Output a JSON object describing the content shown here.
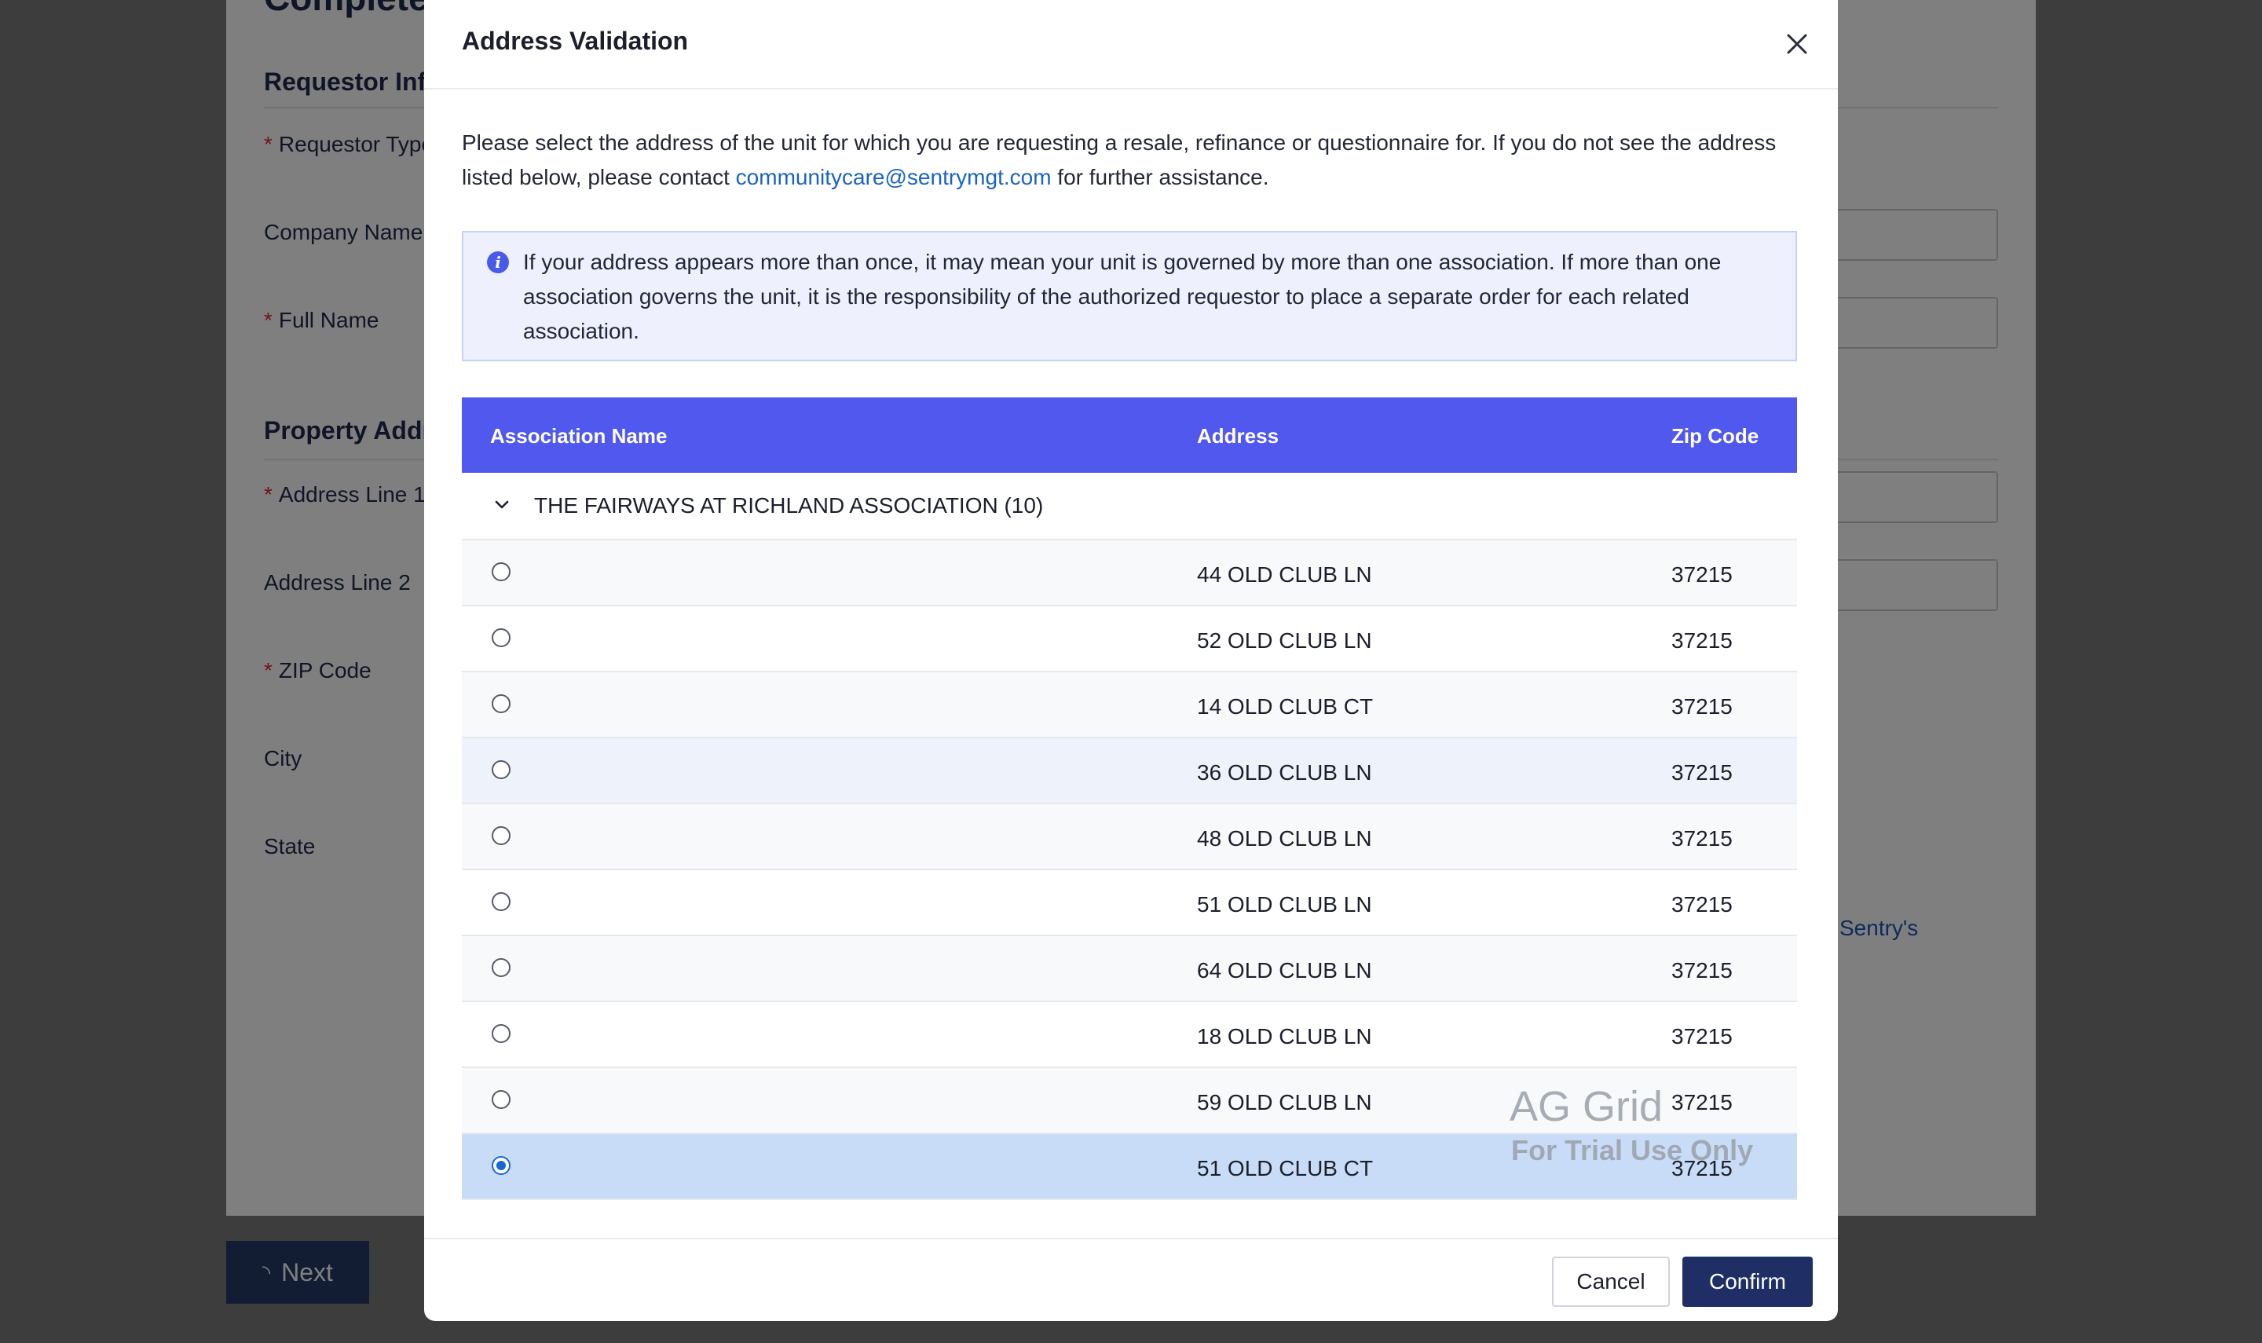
{
  "background": {
    "page_title": "Complete",
    "requestor_section": "Requestor Info",
    "requestor_type_label": "Requestor Type",
    "company_name_label": "Company Name",
    "full_name_label": "Full Name",
    "property_section": "Property Address",
    "address_line1_label": "Address Line 1",
    "address_line2_label": "Address Line 2",
    "zip_label": "ZIP Code",
    "city_label": "City",
    "state_label": "State",
    "partial_link": "Sentry's",
    "required_marker": "*",
    "next_label": "Next"
  },
  "modal": {
    "title": "Address Validation",
    "intro_before": "Please select the address of the unit for which you are requesting a resale, refinance or questionnaire for. If you do not see the address listed below, please contact ",
    "intro_email": "communitycare@sentrymgt.com",
    "intro_after": " for further assistance.",
    "info_icon": "info-icon",
    "info_text": "If your address appears more than once, it may mean your unit is governed by more than one association. If more than one association governs the unit, it is the responsibility of the authorized requestor to place a separate order for each related association.",
    "grid": {
      "columns": [
        "Association Name",
        "Address",
        "Zip Code"
      ],
      "group_label": "THE FAIRWAYS AT RICHLAND ASSOCIATION (10)",
      "rows": [
        {
          "address": "44 OLD CLUB LN",
          "zip": "37215",
          "selected": false
        },
        {
          "address": "52 OLD CLUB LN",
          "zip": "37215",
          "selected": false
        },
        {
          "address": "14 OLD CLUB CT",
          "zip": "37215",
          "selected": false
        },
        {
          "address": "36 OLD CLUB LN",
          "zip": "37215",
          "selected": false
        },
        {
          "address": "48 OLD CLUB LN",
          "zip": "37215",
          "selected": false
        },
        {
          "address": "51 OLD CLUB LN",
          "zip": "37215",
          "selected": false
        },
        {
          "address": "64 OLD CLUB LN",
          "zip": "37215",
          "selected": false
        },
        {
          "address": "18 OLD CLUB LN",
          "zip": "37215",
          "selected": false
        },
        {
          "address": "59 OLD CLUB LN",
          "zip": "37215",
          "selected": false
        },
        {
          "address": "51 OLD CLUB CT",
          "zip": "37215",
          "selected": true
        }
      ],
      "watermark_line1": "AG Grid",
      "watermark_line2": "For Trial Use Only"
    },
    "cancel_label": "Cancel",
    "confirm_label": "Confirm"
  },
  "colors": {
    "grid_header": "#5058ed",
    "selected_row": "#c9dcf7",
    "confirm_button": "#1f2f66",
    "link": "#1a63c4"
  }
}
